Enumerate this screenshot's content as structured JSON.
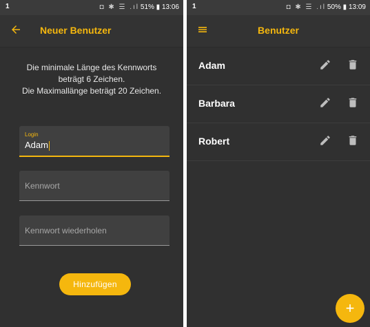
{
  "left_screen": {
    "status_bar": {
      "left": "1",
      "icons": "◘ ✱ ☰ .ıl",
      "right": "51% ▮ 13:06"
    },
    "app_bar": {
      "title": "Neuer Benutzer",
      "back_icon": "arrow-left-icon"
    },
    "info_lines": [
      "Die minimale Länge des Kennworts",
      "beträgt 6 Zeichen.",
      "Die Maximallänge beträgt 20 Zeichen."
    ],
    "login_field": {
      "label": "Login",
      "value": "Adam"
    },
    "password_field": {
      "placeholder": "Kennwort"
    },
    "repeat_field": {
      "placeholder": "Kennwort wiederholen"
    },
    "add_button": "Hinzufügen"
  },
  "right_screen": {
    "status_bar": {
      "left": "1",
      "icons": "◘ ✱ ☰ .ıl",
      "right": "50% ▮ 13:09"
    },
    "app_bar": {
      "title": "Benutzer",
      "menu_icon": "menu-icon"
    },
    "users": [
      "Adam",
      "Barbara",
      "Robert"
    ],
    "fab": "+"
  },
  "colors": {
    "accent": "#f5b70e",
    "background": "#303030",
    "field": "#404040"
  }
}
